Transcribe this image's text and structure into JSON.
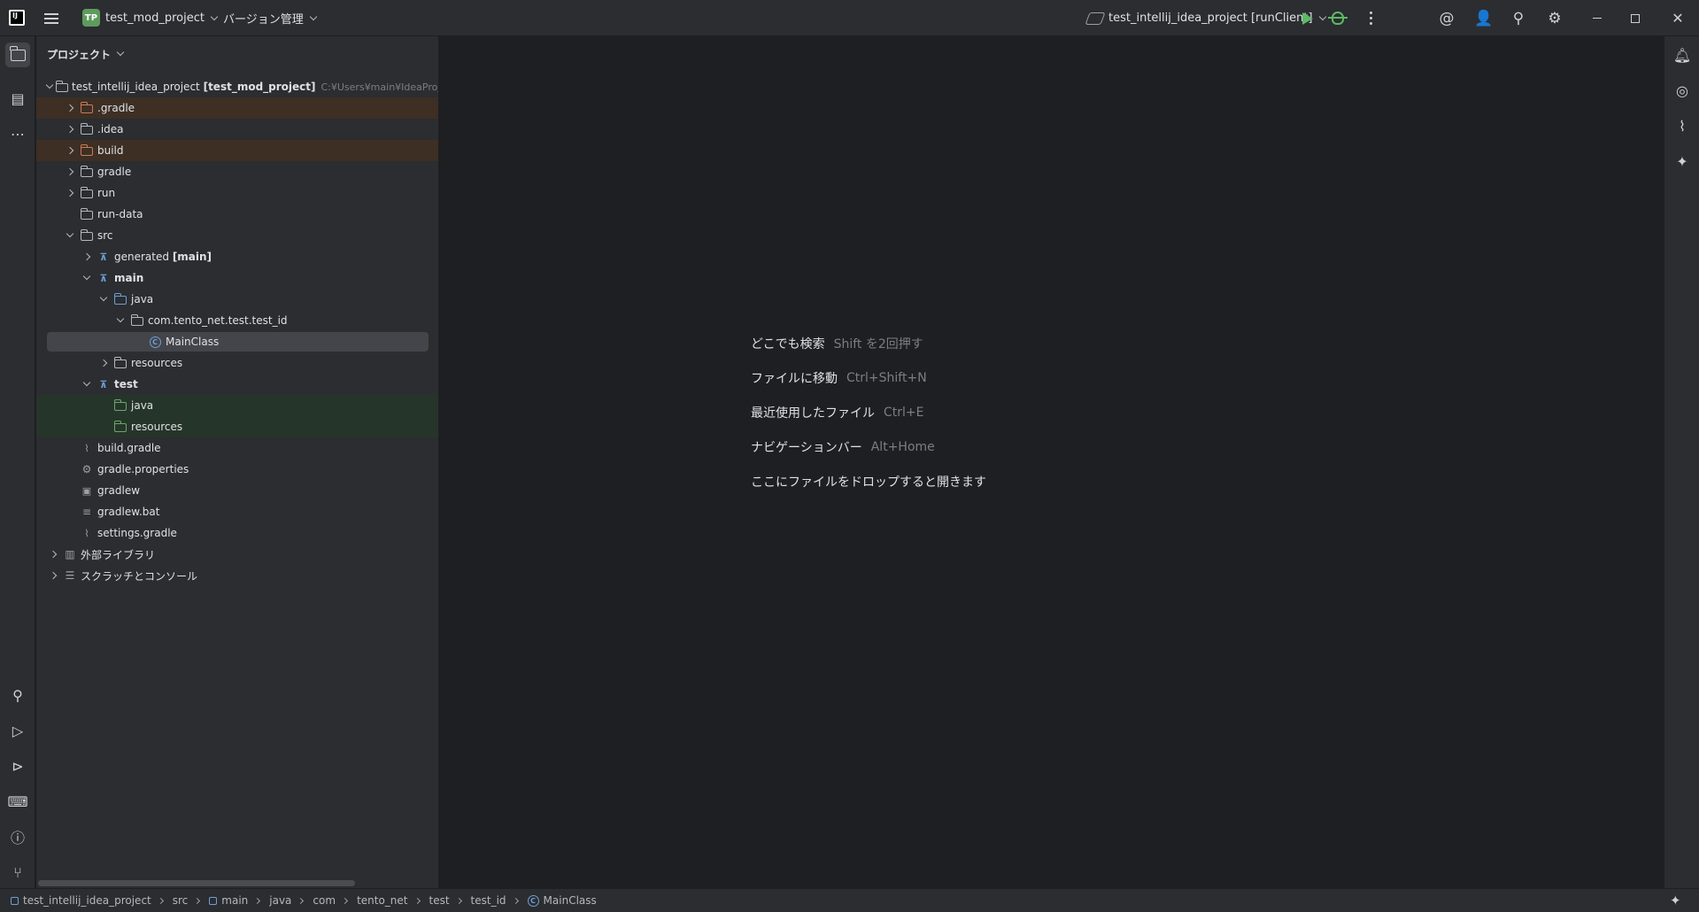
{
  "titlebar": {
    "project_badge": "TP",
    "project_name": "test_mod_project",
    "vcs_label": "バージョン管理",
    "run_config": "test_intellij_idea_project [runClient]"
  },
  "panel": {
    "title": "プロジェクト",
    "tree": {
      "root_name": "test_intellij_idea_project",
      "root_module": "[test_mod_project]",
      "root_path": "C:¥Users¥main¥IdeaProjects¥test",
      "gradle_dir": ".gradle",
      "idea_dir": ".idea",
      "build_dir": "build",
      "gradle": "gradle",
      "run": "run",
      "run_data": "run-data",
      "src": "src",
      "generated": "generated",
      "generated_tag": "[main]",
      "main": "main",
      "java": "java",
      "package": "com.tento_net.test.test_id",
      "main_class": "MainClass",
      "resources": "resources",
      "test": "test",
      "test_java": "java",
      "test_resources": "resources",
      "build_gradle": "build.gradle",
      "gradle_properties": "gradle.properties",
      "gradlew": "gradlew",
      "gradlew_bat": "gradlew.bat",
      "settings_gradle": "settings.gradle",
      "external_libs": "外部ライブラリ",
      "scratches": "スクラッチとコンソール"
    }
  },
  "editor": {
    "hints": [
      {
        "label": "どこでも検索",
        "shortcut": "Shift を2回押す"
      },
      {
        "label": "ファイルに移動",
        "shortcut": "Ctrl+Shift+N"
      },
      {
        "label": "最近使用したファイル",
        "shortcut": "Ctrl+E"
      },
      {
        "label": "ナビゲーションバー",
        "shortcut": "Alt+Home"
      },
      {
        "label": "ここにファイルをドロップすると開きます",
        "shortcut": ""
      }
    ]
  },
  "statusbar": {
    "breadcrumbs": [
      "test_intellij_idea_project",
      "src",
      "main",
      "java",
      "com",
      "tento_net",
      "test",
      "test_id",
      "MainClass"
    ]
  },
  "colors": {
    "background": "#1e1f22",
    "panel": "#2b2d30",
    "excluded_row": "#3d2f24",
    "test_row": "#26352a",
    "accent_blue": "#6d9fd6",
    "run_green": "#5fb865"
  }
}
